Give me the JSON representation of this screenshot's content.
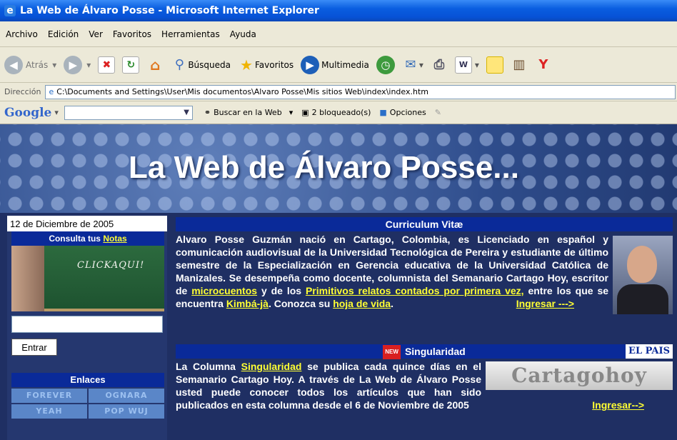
{
  "window": {
    "title": "La Web de Álvaro Posse - Microsoft Internet Explorer"
  },
  "menu": [
    "Archivo",
    "Edición",
    "Ver",
    "Favoritos",
    "Herramientas",
    "Ayuda"
  ],
  "toolbar": {
    "back": "Atrás",
    "search": "Búsqueda",
    "favorites": "Favoritos",
    "media": "Multimedia"
  },
  "address": {
    "label": "Dirección",
    "value": "C:\\Documents and Settings\\User\\Mis documentos\\Alvaro Posse\\Mis sitios Web\\index\\index.htm"
  },
  "google": {
    "logo": "Google",
    "search_web": "Buscar en la Web",
    "blocked": "2 bloqueado(s)",
    "options": "Opciones"
  },
  "banner": {
    "title": "La Web de Álvaro Posse..."
  },
  "sidebar": {
    "date": "12 de Diciembre de 2005",
    "notes_prefix": "Consulta tus",
    "notes_link": "Notas",
    "board_text": "CLICKAQUI!",
    "enter": "Entrar",
    "links_title": "Enlaces",
    "links": [
      "FOREVER",
      "OGNARA",
      "YEAH",
      "POP WUJ"
    ]
  },
  "cv": {
    "title": "Curriculum Vitæ",
    "p1": "Alvaro Posse Guzmán nació en Cartago, Colombia, es Licenciado en español y comunicación audiovisual de la Universidad Tecnológica de Pereira y estudiante de último semestre de la Especialización en Gerencia educativa de la Universidad Católica de Manizales. Se desempeña como docente, columnista del Semanario Cartago Hoy, escritor de",
    "link1": "microcuentos",
    "p2": "y de los",
    "link2": "Primitivos relatos contados por primera vez,",
    "p3": "entre los que se encuentra",
    "link3": "Kimbá-jà",
    "p4": ". Conozca su",
    "link4": "hoja de vida",
    "p5": ".",
    "ingresar": "Ingresar --->"
  },
  "sing": {
    "new": "NEW",
    "title": "Singularidad",
    "elpais": "EL PAIS",
    "cartago": "Cartagohoy",
    "p1": "La Columna",
    "link": "Singularidad",
    "p2": "se publica cada quince días en el Semanario Cartago Hoy. A través de La Web de Álvaro Posse usted puede conocer todos los artículos que han sido publicados en esta columna desde el 6 de Noviembre de 2005",
    "ingresar": "Ingresar-->"
  }
}
